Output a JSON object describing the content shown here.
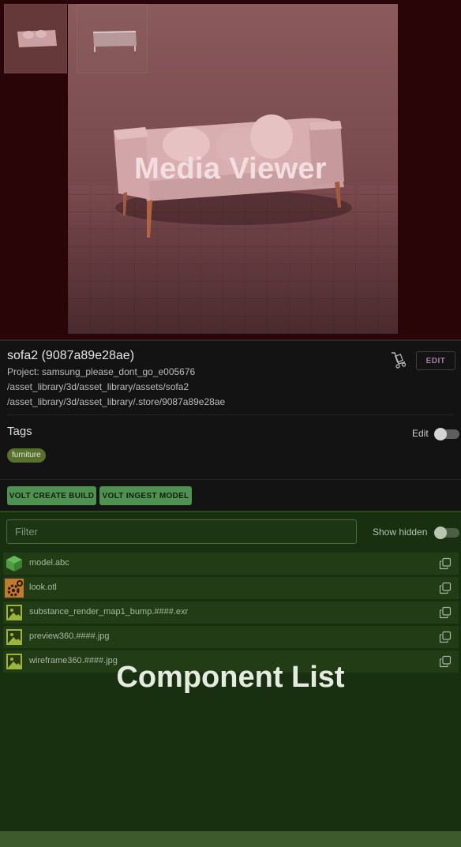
{
  "media_viewer": {
    "overlay_label": "Media Viewer",
    "thumbnails": [
      "thumbnail-1",
      "thumbnail-2"
    ]
  },
  "asset": {
    "title": "sofa2 (9087a89e28ae)",
    "project_line": "Project: samsung_please_dont_go_e005676",
    "path_line": "/asset_library/3d/asset_library/assets/sofa2",
    "store_line": "/asset_library/3d/asset_library/.store/9087a89e28ae",
    "edit_button": "EDIT",
    "cart_icon": "hand-truck-icon"
  },
  "tags": {
    "label": "Tags",
    "edit_toggle_label": "Edit",
    "edit_toggle_on": false,
    "items": [
      "furniture"
    ]
  },
  "actions": {
    "volt_create_build": "VOLT CREATE BUILD",
    "volt_ingest_model": "VOLT INGEST MODEL"
  },
  "components": {
    "overlay_label": "Component List",
    "filter_placeholder": "Filter",
    "show_hidden_label": "Show hidden",
    "show_hidden_on": false,
    "items": [
      {
        "name": "model.abc",
        "icon": "cube-icon"
      },
      {
        "name": "look.otl",
        "icon": "gear-icon"
      },
      {
        "name": "substance_render_map1_bump.####.exr",
        "icon": "image-icon"
      },
      {
        "name": "preview360.####.jpg",
        "icon": "image-icon"
      },
      {
        "name": "wireframe360.####.jpg",
        "icon": "image-icon"
      }
    ]
  },
  "colors": {
    "media_tint": "#2a0508",
    "component_tint": "#18300f",
    "action_button": "#4f9150",
    "tag_chip": "#58702e"
  }
}
